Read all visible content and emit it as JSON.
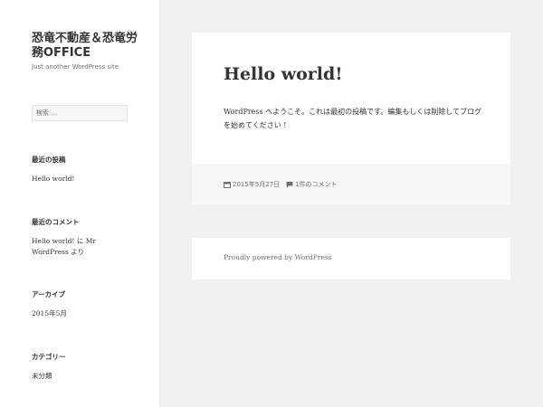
{
  "site": {
    "title": "恐竜不動産＆恐竜労務OFFICE",
    "description": "Just another WordPress site"
  },
  "search": {
    "placeholder": "検索 …"
  },
  "widgets": {
    "recent_posts": {
      "title": "最近の投稿",
      "items": [
        "Hello world!"
      ]
    },
    "recent_comments": {
      "title": "最近のコメント",
      "post_link": "Hello world!",
      "connector": "に",
      "author": "Mr WordPress",
      "suffix": "より"
    },
    "archives": {
      "title": "アーカイブ",
      "items": [
        "2015年5月"
      ]
    },
    "categories": {
      "title": "カテゴリー",
      "items": [
        "未分類"
      ]
    }
  },
  "post": {
    "title": "Hello world!",
    "body": "WordPress へようこそ。これは最初の投稿です。編集もしくは削除してブログを始めてください !",
    "date": "2015年5月27日",
    "comments": "1件のコメント",
    "date_icon": "calendar-icon",
    "comment_icon": "comment-icon"
  },
  "footer": {
    "credit": "Proudly powered by WordPress"
  },
  "colors": {
    "page_bg": "#f1f1f1",
    "sidebar_bg": "#ffffff",
    "card_bg": "#ffffff",
    "post_footer_bg": "#f7f7f7",
    "text": "#333333",
    "muted": "#707070"
  }
}
